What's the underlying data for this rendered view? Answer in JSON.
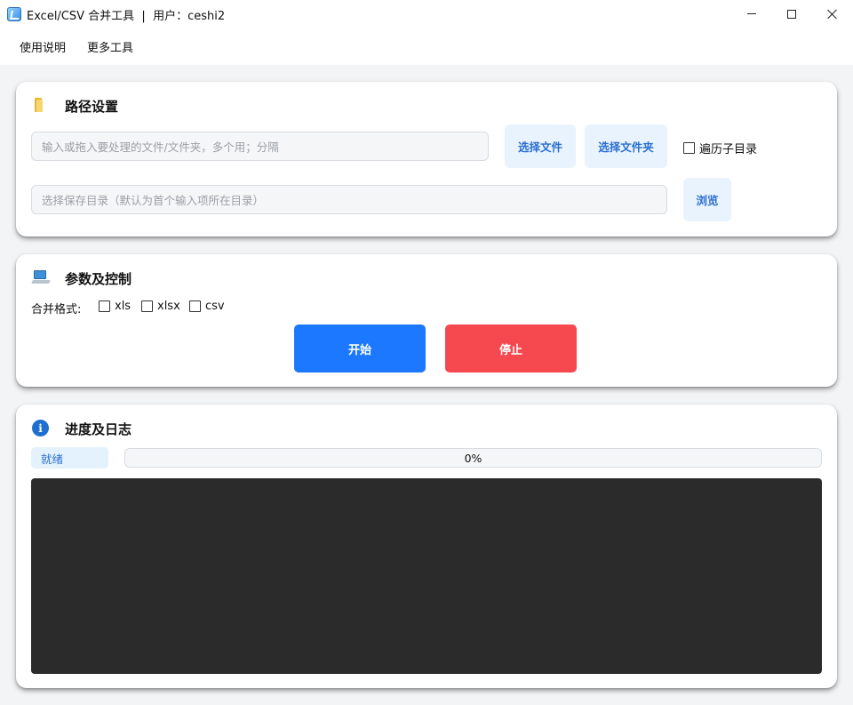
{
  "window": {
    "title": "Excel/CSV 合并工具  |  用户：ceshi2"
  },
  "menu": {
    "items": [
      "使用说明",
      "更多工具"
    ]
  },
  "path_section": {
    "title": "路径设置",
    "icon": "folder-icon",
    "input_placeholder": "输入或拖入要处理的文件/文件夹，多个用；分隔",
    "input_value": "",
    "select_file_label": "选择文件",
    "select_folder_label": "选择文件夹",
    "recursive_label": "遍历子目录",
    "recursive_checked": false,
    "save_placeholder": "选择保存目录（默认为首个输入项所在目录）",
    "save_value": "",
    "browse_label": "浏览"
  },
  "params_section": {
    "title": "参数及控制",
    "icon": "laptop-icon",
    "format_label": "合并格式:",
    "formats": [
      {
        "label": "xls",
        "checked": false
      },
      {
        "label": "xlsx",
        "checked": false
      },
      {
        "label": "csv",
        "checked": false
      }
    ],
    "start_label": "开始",
    "stop_label": "停止",
    "colors": {
      "start": "#1c78ff",
      "stop": "#f6484f"
    }
  },
  "progress_section": {
    "title": "进度及日志",
    "icon": "info-icon",
    "status": "就绪",
    "progress_text": "0%",
    "progress_value": 0,
    "log_text": ""
  }
}
